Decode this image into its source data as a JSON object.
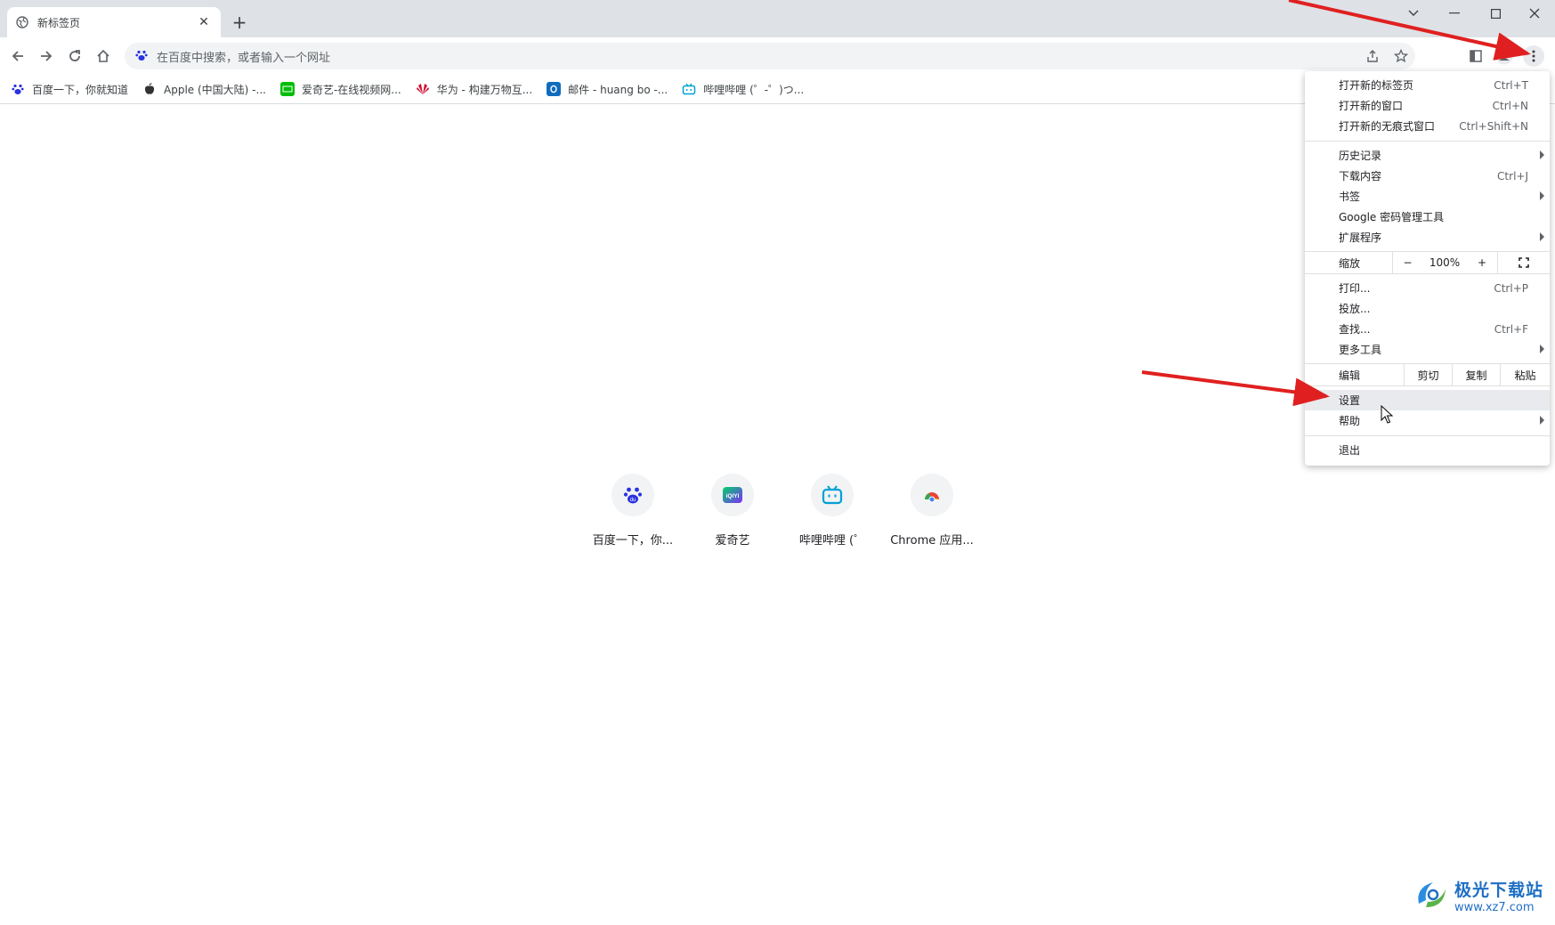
{
  "tab": {
    "title": "新标签页",
    "close": "✕"
  },
  "newtab": "+",
  "window": {
    "min": "—",
    "max": "☐",
    "close": "✕",
    "dropdown": "⌄"
  },
  "omnibox": {
    "placeholder": "在百度中搜索，或者输入一个网址"
  },
  "bookmarks": [
    {
      "label": "百度一下，你就知道",
      "color": "#2932e1"
    },
    {
      "label": "Apple (中国大陆) -...",
      "color": "#333333"
    },
    {
      "label": "爱奇艺-在线视频网...",
      "color": "#00be06"
    },
    {
      "label": "华为 - 构建万物互...",
      "color": "#cf0a2c"
    },
    {
      "label": "邮件 - huang bo -...",
      "color": "#0f6cbd"
    },
    {
      "label": "哔哩哔哩 (゜-゜)つ...",
      "color": "#00a1d6"
    }
  ],
  "shortcuts": [
    {
      "label": "百度一下，你...",
      "icon_text": "du"
    },
    {
      "label": "爱奇艺",
      "icon_text": "iQIYI"
    },
    {
      "label": "哔哩哔哩 (゜",
      "icon_text": ""
    },
    {
      "label": "Chrome 应用...",
      "icon_text": ""
    }
  ],
  "menu": {
    "new_tab": {
      "label": "打开新的标签页",
      "shortcut": "Ctrl+T"
    },
    "new_window": {
      "label": "打开新的窗口",
      "shortcut": "Ctrl+N"
    },
    "incognito": {
      "label": "打开新的无痕式窗口",
      "shortcut": "Ctrl+Shift+N"
    },
    "history": {
      "label": "历史记录"
    },
    "downloads": {
      "label": "下载内容",
      "shortcut": "Ctrl+J"
    },
    "bookmarks": {
      "label": "书签"
    },
    "passwords": {
      "label": "Google 密码管理工具"
    },
    "extensions": {
      "label": "扩展程序"
    },
    "zoom": {
      "label": "缩放",
      "minus": "−",
      "value": "100%",
      "plus": "+"
    },
    "print": {
      "label": "打印...",
      "shortcut": "Ctrl+P"
    },
    "cast": {
      "label": "投放..."
    },
    "find": {
      "label": "查找...",
      "shortcut": "Ctrl+F"
    },
    "more_tools": {
      "label": "更多工具"
    },
    "edit": {
      "label": "编辑",
      "cut": "剪切",
      "copy": "复制",
      "paste": "粘贴"
    },
    "settings": {
      "label": "设置"
    },
    "help": {
      "label": "帮助"
    },
    "exit": {
      "label": "退出"
    }
  },
  "watermark": {
    "name": "极光下载站",
    "url": "www.xz7.com"
  },
  "colors": {
    "annotation_arrow": "#e02020",
    "tabstrip": "#dee1e6",
    "menu_highlight": "#e8eaed"
  }
}
